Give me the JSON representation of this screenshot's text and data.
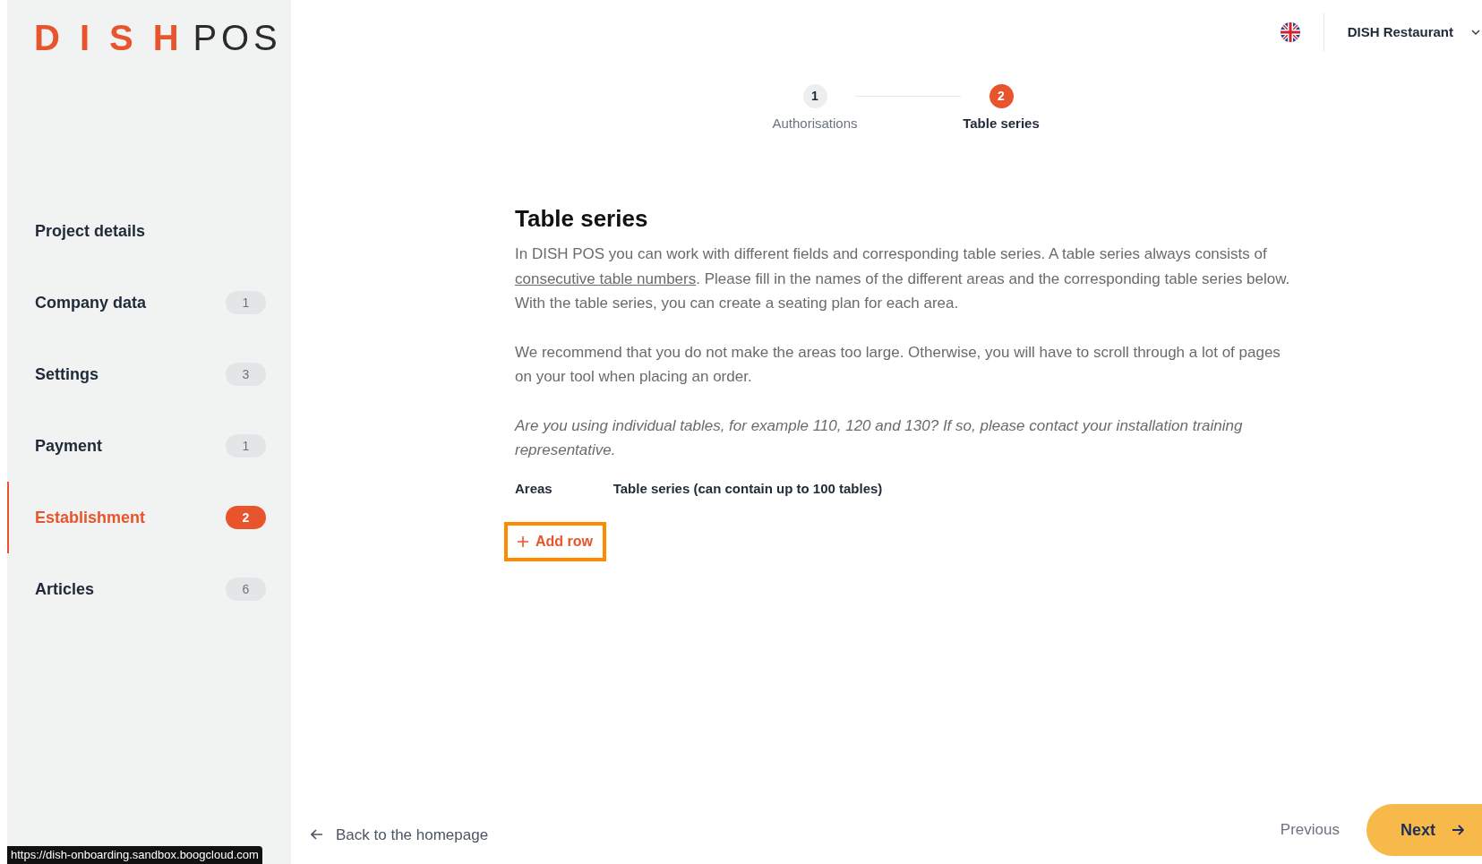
{
  "logo": {
    "brand": "DISH",
    "product": "POS"
  },
  "sidebar": {
    "items": [
      {
        "label": "Project details",
        "selected": false
      },
      {
        "label": "Company data",
        "badge": "1",
        "selected": false
      },
      {
        "label": "Settings",
        "badge": "3",
        "selected": false
      },
      {
        "label": "Payment",
        "badge": "1",
        "selected": false
      },
      {
        "label": "Establishment",
        "badge": "2",
        "selected": true
      },
      {
        "label": "Articles",
        "badge": "6",
        "selected": false
      }
    ]
  },
  "header": {
    "restaurant": "DISH Restaurant"
  },
  "steps": [
    {
      "number": "1",
      "label": "Authorisations",
      "selected": false
    },
    {
      "number": "2",
      "label": "Table series",
      "selected": true
    }
  ],
  "content": {
    "title": "Table series",
    "paragraphs": [
      {
        "kind": "text",
        "before": "In DISH POS you can work with different fields and corresponding table series. A table series always consists of ",
        "link": "consecutive table numbers",
        "after": ". Please fill in the names of the different areas and the corresponding table series below. With the table series, you can create a seating plan for each area."
      },
      {
        "kind": "text",
        "before": "We recommend that you do not make the areas too large. Otherwise, you will have to scroll through a lot of pages on your tool when placing an order."
      },
      {
        "kind": "note",
        "before": "Are you using individual tables, for example 110, 120 and 130? If so, please contact your installation training representative."
      }
    ],
    "columns": [
      "Areas",
      "Table series (can contain up to 100 tables)"
    ],
    "add_row": {
      "label": "Add row",
      "highlighted": true
    }
  },
  "footer": {
    "back": "Back to the homepage",
    "previous": "Previous",
    "next": "Next"
  },
  "status_url": "https://dish-onboarding.sandbox.boogcloud.com"
}
